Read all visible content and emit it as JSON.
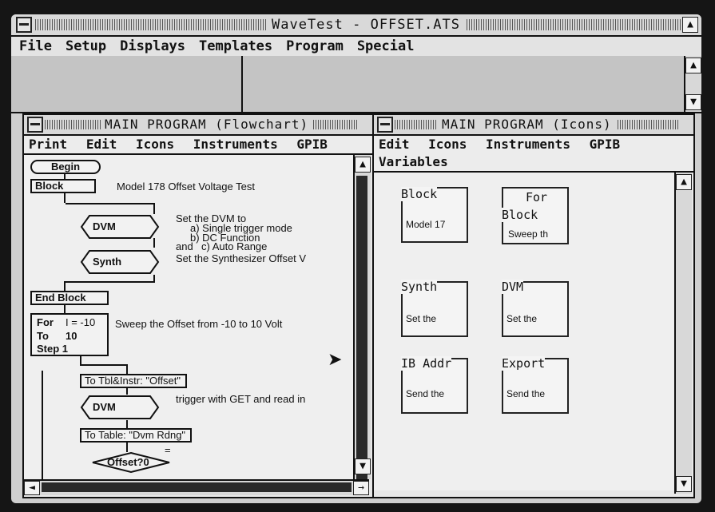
{
  "app": {
    "title": "WaveTest - OFFSET.ATS",
    "menu": [
      "File",
      "Setup",
      "Displays",
      "Templates",
      "Program",
      "Special"
    ]
  },
  "flowchart_window": {
    "title": "MAIN PROGRAM (Flowchart)",
    "menu": [
      "Print",
      "Edit",
      "Icons",
      "Instruments",
      "GPIB"
    ],
    "nodes": {
      "begin": "Begin",
      "block": "Block",
      "block_text": "Model 178 Offset Voltage Test",
      "dvm1": "DVM",
      "dvm1_text": [
        "Set the DVM to",
        "a) Single trigger mode",
        "b) DC Function",
        "and",
        "c) Auto Range"
      ],
      "synth": "Synth",
      "synth_text": "Set the Synthesizer Offset V",
      "end_block": "End Block",
      "for_lines": [
        "For",
        "I = -10",
        "To",
        "10",
        "Step 1"
      ],
      "for_text": "Sweep the Offset from -10 to 10 Volt",
      "to_tbl": "To Tbl&Instr: \"Offset\"",
      "dvm2": "DVM",
      "dvm2_text": "trigger with GET and read in",
      "to_table": "To Table: \"Dvm Rdng\"",
      "decision": "Offset?0",
      "equals": "="
    }
  },
  "icons_window": {
    "title": "MAIN PROGRAM (Icons)",
    "menu": [
      "Edit",
      "Icons",
      "Instruments",
      "GPIB",
      "Variables"
    ],
    "icons": [
      {
        "name": "Block",
        "desc": "Model 17"
      },
      {
        "name": "For",
        "name2": "Block",
        "desc": "Sweep th"
      },
      {
        "name": "Synth",
        "desc": "Set the"
      },
      {
        "name": "DVM",
        "desc": "Set the"
      },
      {
        "name": "IB Addr",
        "desc": "Send the"
      },
      {
        "name": "Export",
        "desc": "Send the"
      }
    ]
  },
  "scroll_glyphs": {
    "up": "▲",
    "down": "▼",
    "left": "◄",
    "right": "→"
  }
}
